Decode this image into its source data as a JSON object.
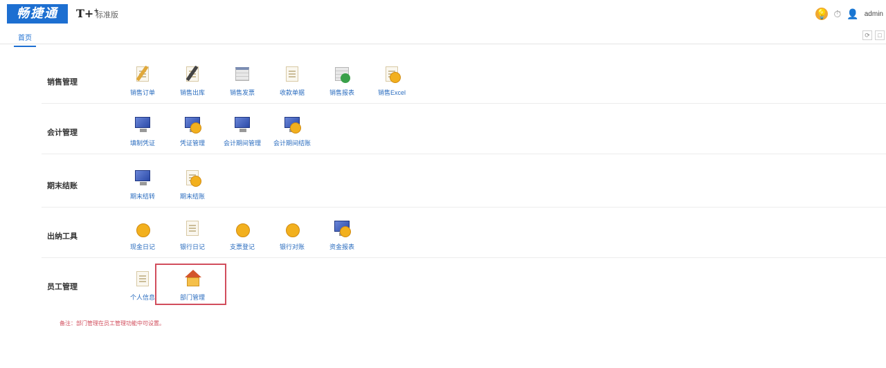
{
  "header": {
    "logo_text": "畅捷通",
    "product": "T+",
    "edition": "标准版",
    "user": "admin"
  },
  "tabs": [
    {
      "label": "首页"
    }
  ],
  "sections": [
    {
      "title": "销售管理",
      "items": [
        {
          "label": "销售订单",
          "icon": "pencil-doc-icon"
        },
        {
          "label": "销售出库",
          "icon": "pencil-doc-icon"
        },
        {
          "label": "销售发票",
          "icon": "table-icon"
        },
        {
          "label": "收款单据",
          "icon": "doc-icon"
        },
        {
          "label": "销售报表",
          "icon": "check-icon"
        },
        {
          "label": "销售Excel",
          "icon": "coin-doc-icon"
        }
      ]
    },
    {
      "title": "会计管理",
      "items": [
        {
          "label": "填制凭证",
          "icon": "monitor-icon"
        },
        {
          "label": "凭证管理",
          "icon": "monitor-coin-icon"
        },
        {
          "label": "会计期间管理",
          "icon": "monitor-icon"
        },
        {
          "label": "会计期间结账",
          "icon": "monitor-coin-icon"
        }
      ]
    },
    {
      "title": "期末结账",
      "items": [
        {
          "label": "期末结转",
          "icon": "monitor-icon"
        },
        {
          "label": "期末结账",
          "icon": "doc-coin-icon"
        }
      ]
    },
    {
      "title": "出纳工具",
      "items": [
        {
          "label": "现金日记",
          "icon": "coin-icon"
        },
        {
          "label": "银行日记",
          "icon": "doc-icon"
        },
        {
          "label": "支票登记",
          "icon": "coin-icon"
        },
        {
          "label": "银行对账",
          "icon": "coin-icon"
        },
        {
          "label": "资金报表",
          "icon": "monitor-coin-icon"
        }
      ]
    },
    {
      "title": "员工管理",
      "items": [
        {
          "label": "个人信息",
          "icon": "doc-icon"
        },
        {
          "label": "部门管理",
          "icon": "house-icon"
        }
      ]
    }
  ],
  "note": "备注：部门管理在员工管理功能中可设置。"
}
